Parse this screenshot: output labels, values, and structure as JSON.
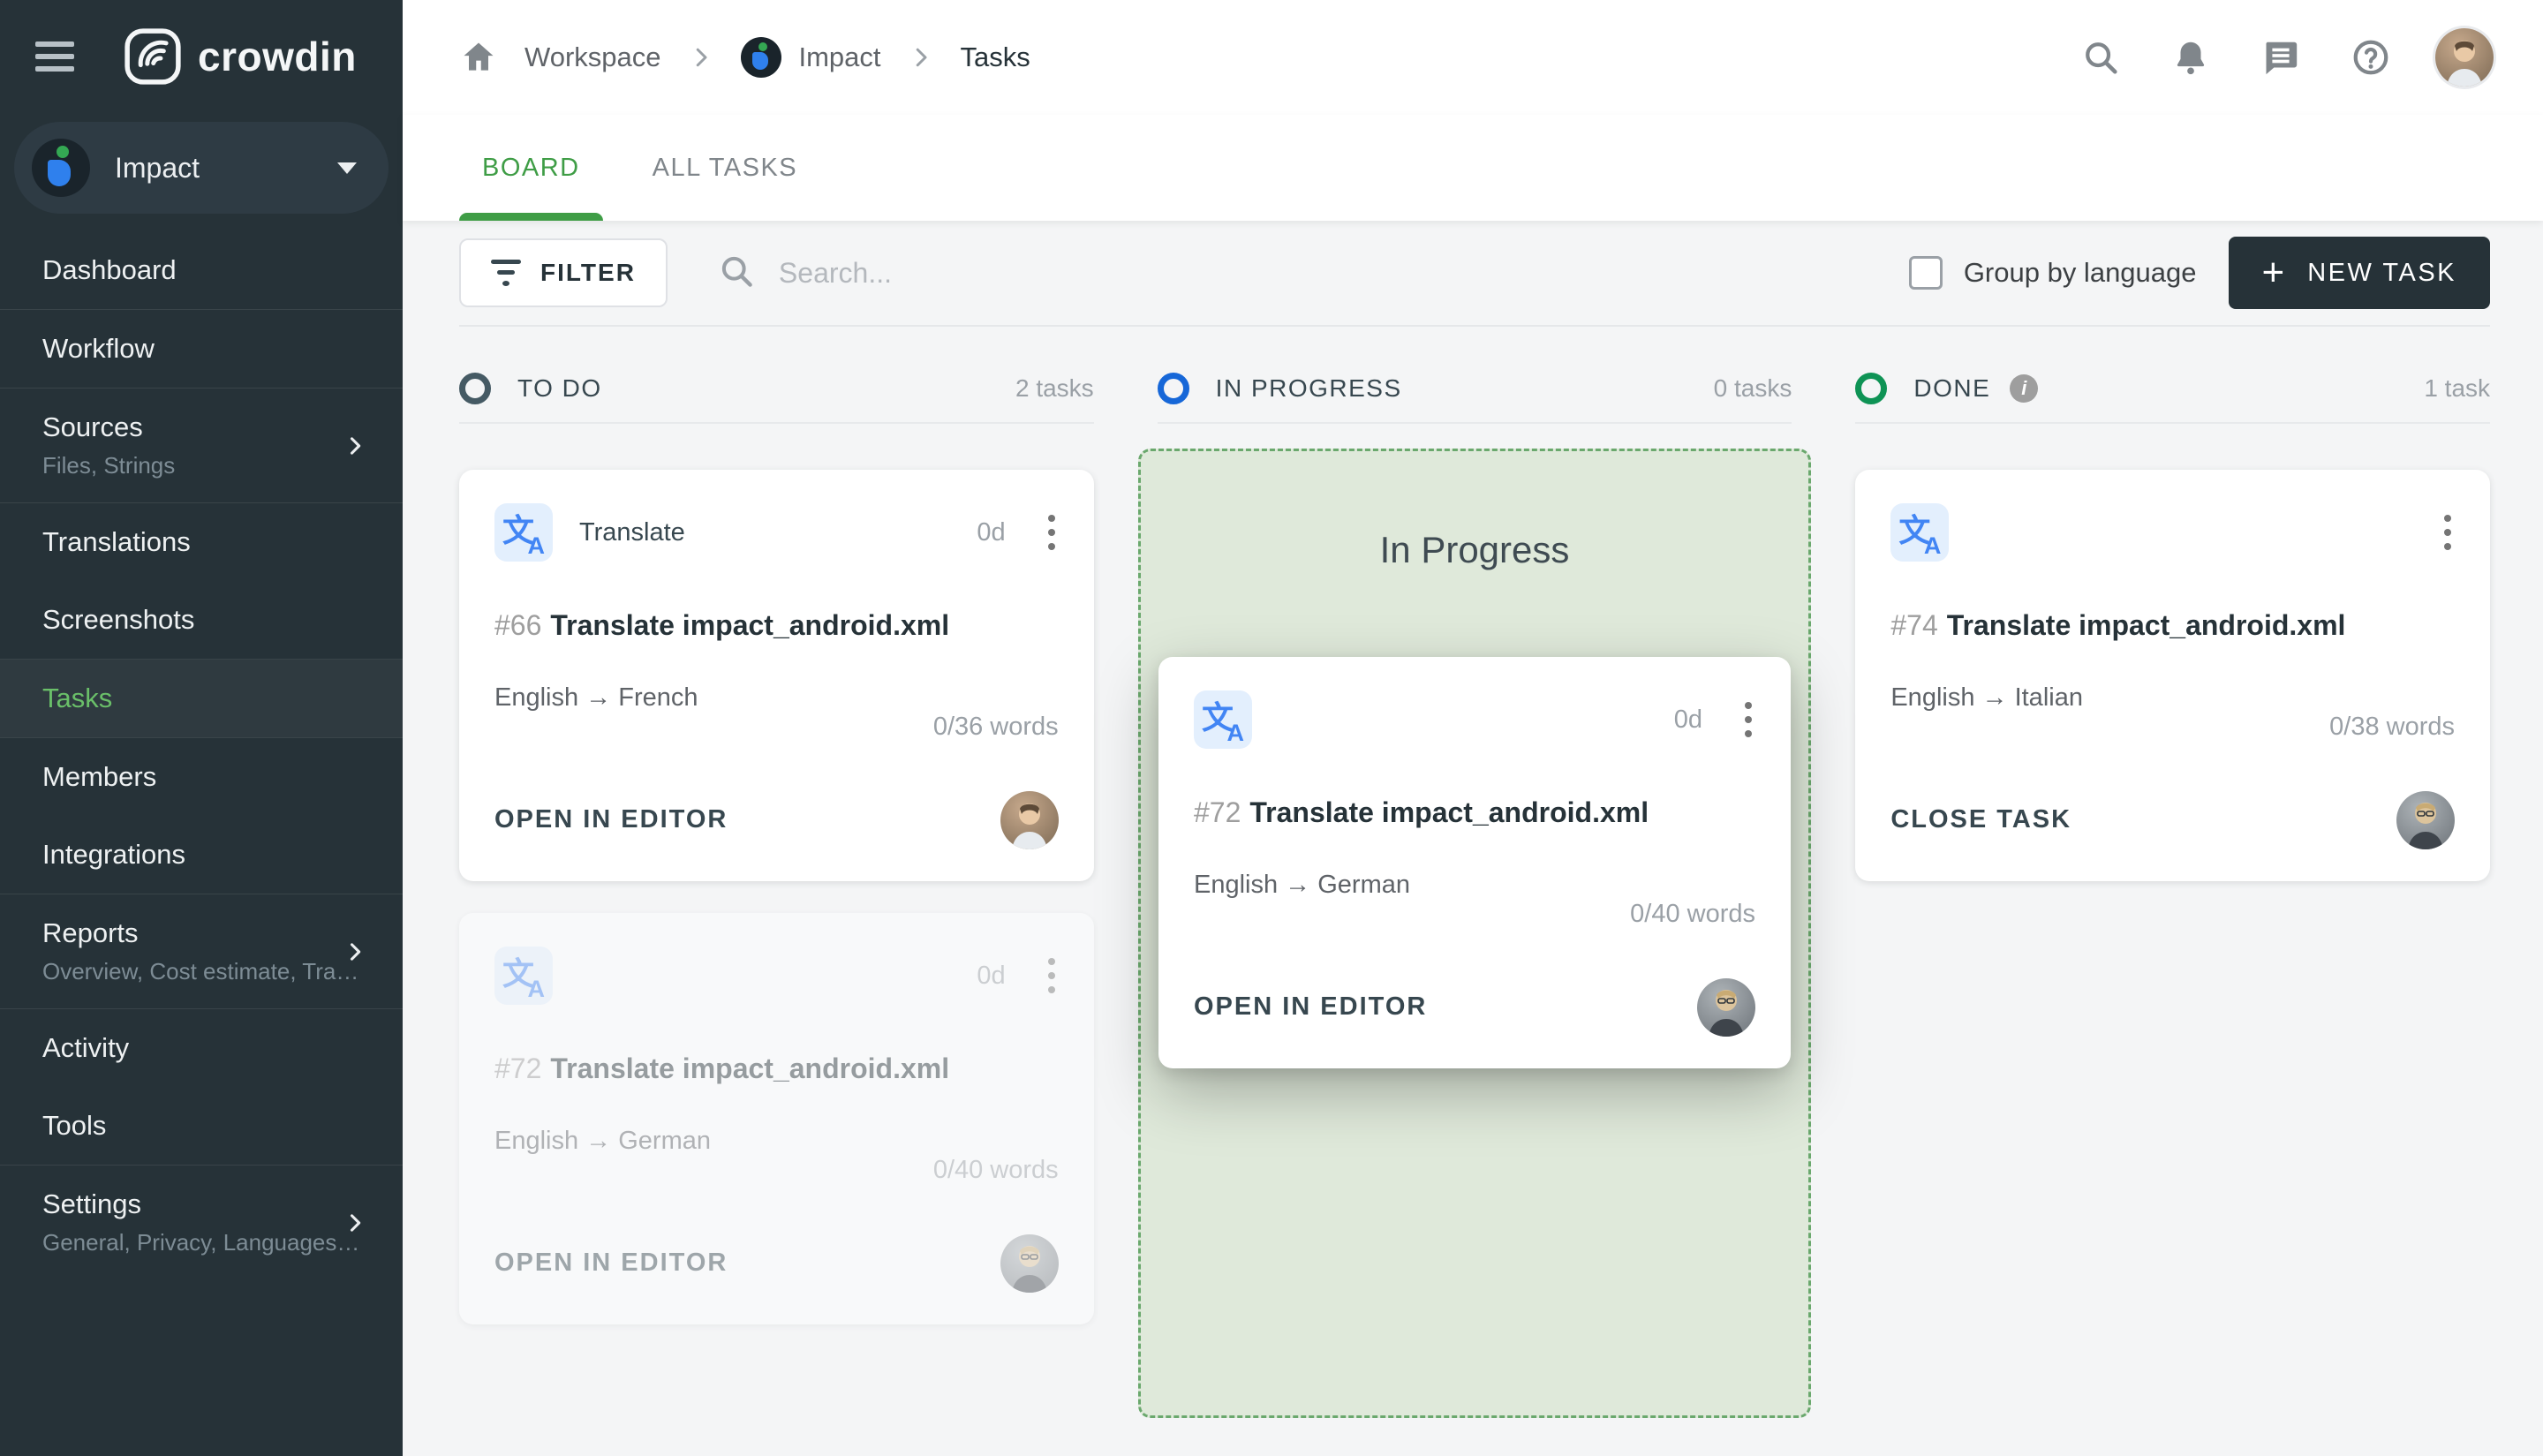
{
  "app": {
    "logo_text": "crowdin"
  },
  "sidebar": {
    "project": {
      "name": "Impact"
    },
    "items": [
      {
        "label": "Dashboard"
      },
      {
        "label": "Workflow"
      },
      {
        "label": "Sources",
        "subtitle": "Files, Strings"
      },
      {
        "label": "Translations"
      },
      {
        "label": "Screenshots"
      },
      {
        "label": "Tasks"
      },
      {
        "label": "Members"
      },
      {
        "label": "Integrations"
      },
      {
        "label": "Reports",
        "subtitle": "Overview, Cost estimate, Transl…"
      },
      {
        "label": "Activity"
      },
      {
        "label": "Tools"
      },
      {
        "label": "Settings",
        "subtitle": "General, Privacy, Languages, Q…"
      }
    ]
  },
  "breadcrumb": {
    "workspace": "Workspace",
    "project": "Impact",
    "page": "Tasks"
  },
  "tabs": [
    {
      "label": "BOARD"
    },
    {
      "label": "ALL TASKS"
    }
  ],
  "toolbar": {
    "filter_label": "FILTER",
    "search_placeholder": "Search...",
    "group_by_language_label": "Group by language",
    "plus_glyph": "+",
    "new_task_label": "NEW TASK"
  },
  "board": {
    "columns": [
      {
        "name": "TO DO",
        "count": "2 tasks",
        "ring_color": "#455a64"
      },
      {
        "name": "IN PROGRESS",
        "count": "0 tasks",
        "ring_color": "#1667d8"
      },
      {
        "name": "DONE",
        "count": "1 task",
        "ring_color": "#0e9355"
      }
    ],
    "info_glyph": "i",
    "dropzone_label": "In Progress",
    "icon_glyphs": {
      "zh": "文",
      "a": "A"
    },
    "cards": [
      {
        "type_label": "Translate",
        "due": "0d",
        "id": "#66",
        "title": "Translate impact_android.xml",
        "languages": "English → French",
        "words": "0/36 words",
        "action": "OPEN IN EDITOR"
      },
      {
        "due": "0d",
        "id": "#72",
        "title": "Translate impact_android.xml",
        "languages": "English → German",
        "words": "0/40 words",
        "action": "OPEN IN EDITOR"
      },
      {
        "due": "0d",
        "id": "#72",
        "title": "Translate impact_android.xml",
        "languages": "English → German",
        "words": "0/40 words",
        "action": "OPEN IN EDITOR"
      },
      {
        "id": "#74",
        "title": "Translate impact_android.xml",
        "languages": "English → Italian",
        "words": "0/38 words",
        "action": "CLOSE TASK"
      }
    ]
  }
}
